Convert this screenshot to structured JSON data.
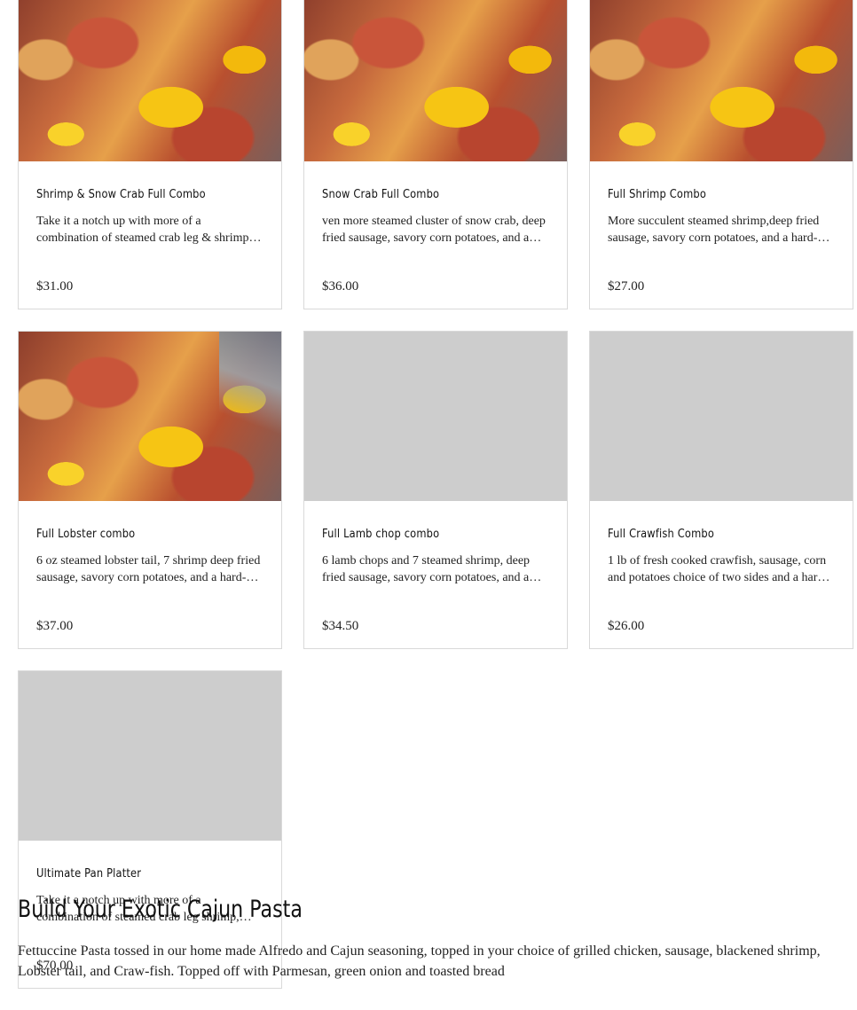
{
  "menu_items": [
    {
      "title": "Shrimp & Snow Crab Full Combo",
      "description": "Take it a notch up with more of a combination of steamed crab leg & shrimp, deep fried sausage, savory corn potatoes, and a hard-boiled egg",
      "price": "$31.00",
      "image": "seafood-boil-photo"
    },
    {
      "title": "Snow Crab Full Combo",
      "description": "ven more steamed cluster of snow crab, deep fried sausage, savory corn potatoes, and a hard-boiled egg",
      "price": "$36.00",
      "image": "seafood-boil-photo"
    },
    {
      "title": "Full Shrimp Combo",
      "description": "More succulent steamed shrimp,deep fried sausage, savory corn potatoes, and a hard-boiled egg",
      "price": "$27.00",
      "image": "seafood-boil-photo"
    },
    {
      "title": "Full Lobster combo",
      "description": "6 oz steamed lobster tail, 7 shrimp deep fried sausage, savory corn potatoes, and a hard-boiled egg",
      "price": "$37.00",
      "image": "seafood-boil-photo"
    },
    {
      "title": "Full Lamb chop combo",
      "description": "6 lamb chops and 7 steamed shrimp, deep fried sausage, savory corn potatoes, and a hard-boiled egg",
      "price": "$34.50",
      "image": "placeholder"
    },
    {
      "title": "Full Crawfish Combo",
      "description": "1 lb of fresh cooked crawfish, sausage, corn and potatoes choice of two sides and a hard-boiled egg",
      "price": "$26.00",
      "image": "placeholder"
    },
    {
      "title": "Ultimate Pan Platter",
      "description": "Take it a notch up with more of a combination of steamed crab leg shrimp, lobster tail, deep fried sausage, savory corn potatoes",
      "price": "$70.00",
      "image": "placeholder"
    }
  ],
  "section": {
    "heading": "Build Your Exotic Cajun Pasta",
    "description": "Fettuccine Pasta tossed in our home made Alfredo and Cajun seasoning, topped in your choice of grilled chicken, sausage, blackened shrimp, Lobster tail, and Craw-fish. Topped off with Parmesan, green onion and toasted bread"
  }
}
